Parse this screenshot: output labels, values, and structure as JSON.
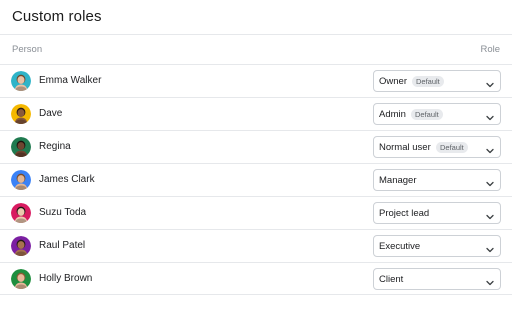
{
  "page": {
    "title": "Custom roles"
  },
  "columns": {
    "person": "Person",
    "role": "Role"
  },
  "people": [
    {
      "name": "Emma Walker",
      "role": "Owner",
      "badge": "Default",
      "avatar_bg": "#2fb4c8",
      "skin": "#e9c2a6",
      "hair": "#6b4a2e"
    },
    {
      "name": "Dave",
      "role": "Admin",
      "badge": "Default",
      "avatar_bg": "#f5b800",
      "skin": "#8a5a3c",
      "hair": "#2b1a10"
    },
    {
      "name": "Regina",
      "role": "Normal user",
      "badge": "Default",
      "avatar_bg": "#1f7a4f",
      "skin": "#6e4530",
      "hair": "#1a120c"
    },
    {
      "name": "James Clark",
      "role": "Manager",
      "badge": "",
      "avatar_bg": "#3b82f6",
      "skin": "#e3b796",
      "hair": "#7a4b2a"
    },
    {
      "name": "Suzu Toda",
      "role": "Project lead",
      "badge": "",
      "avatar_bg": "#d81b60",
      "skin": "#ecc9ae",
      "hair": "#1b1411"
    },
    {
      "name": "Raul Patel",
      "role": "Executive",
      "badge": "",
      "avatar_bg": "#7b1fa2",
      "skin": "#a8724f",
      "hair": "#241812"
    },
    {
      "name": "Holly Brown",
      "role": "Client",
      "badge": "",
      "avatar_bg": "#1e8e3e",
      "skin": "#e6b99a",
      "hair": "#8a5a32"
    }
  ]
}
